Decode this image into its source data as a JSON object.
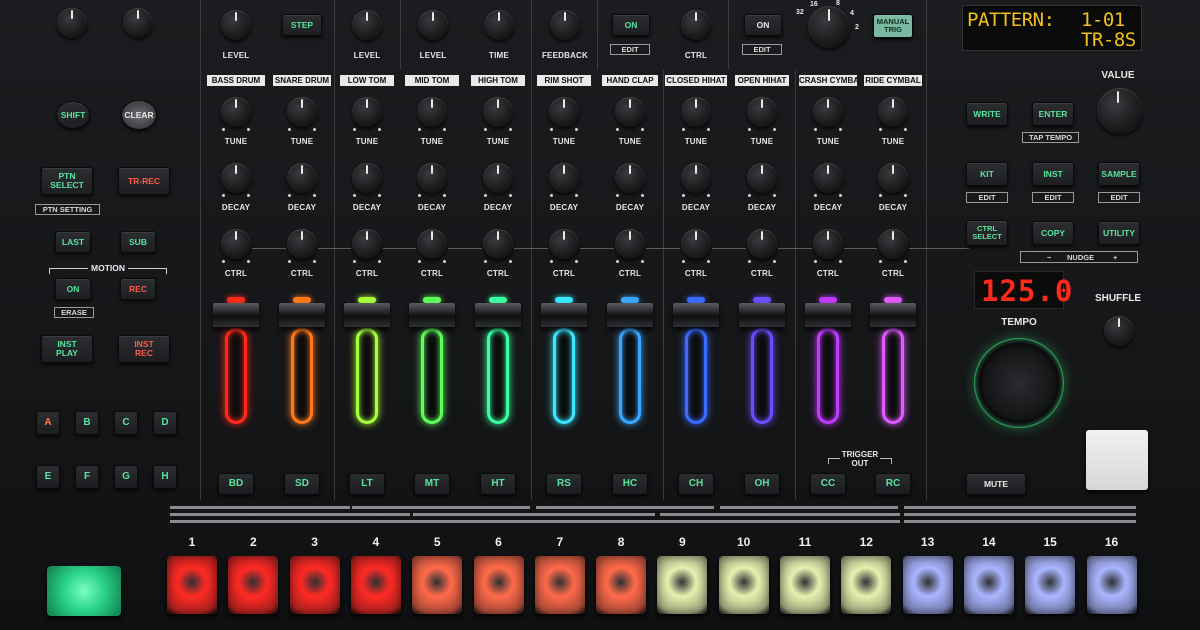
{
  "top": {
    "knob_labels": [
      "LEVEL",
      "LEVEL",
      "LEVEL",
      "TIME",
      "FEEDBACK",
      "CTRL"
    ],
    "step_label": "STEP",
    "on_label": "ON",
    "edit_label": "EDIT",
    "ctrl_label": "CTRL",
    "manual_trig": [
      "MANUAL",
      "TRIG"
    ],
    "step_values": [
      "32",
      "16",
      "8",
      "4",
      "2"
    ]
  },
  "display": {
    "line1_left": "PATTERN:",
    "line1_right": "1-01",
    "line2_right": "TR-8S"
  },
  "instruments": [
    {
      "header": "BASS DRUM",
      "button": "BD",
      "color": "#ff2a1a"
    },
    {
      "header": "SNARE DRUM",
      "button": "SD",
      "color": "#ff7a1a"
    },
    {
      "header": "LOW TOM",
      "button": "LT",
      "color": "#a8ff3a"
    },
    {
      "header": "MID TOM",
      "button": "MT",
      "color": "#5dff5a"
    },
    {
      "header": "HIGH TOM",
      "button": "HT",
      "color": "#3affa0"
    },
    {
      "header": "RIM SHOT",
      "button": "RS",
      "color": "#3ae6ff"
    },
    {
      "header": "HAND CLAP",
      "button": "HC",
      "color": "#3aa6ff"
    },
    {
      "header": "CLOSED HIHAT",
      "button": "CH",
      "color": "#3a6bff"
    },
    {
      "header": "OPEN HIHAT",
      "button": "OH",
      "color": "#6a4dff"
    },
    {
      "header": "CRASH CYMBAL",
      "button": "CC",
      "color": "#c23aff"
    },
    {
      "header": "RIDE CYMBAL",
      "button": "RC",
      "color": "#e05aff"
    }
  ],
  "knob_rows": [
    "TUNE",
    "DECAY",
    "CTRL"
  ],
  "left": {
    "shift": "SHIFT",
    "clear": "CLEAR",
    "ptn_select": [
      "PTN",
      "SELECT"
    ],
    "tr_rec": "TR-REC",
    "ptn_setting": "PTN SETTING",
    "last": "LAST",
    "sub": "SUB",
    "motion": "MOTION",
    "on": "ON",
    "rec": "REC",
    "erase": "ERASE",
    "inst_play": [
      "INST",
      "PLAY"
    ],
    "inst_rec": [
      "INST",
      "REC"
    ],
    "banks": [
      "A",
      "B",
      "C",
      "D",
      "E",
      "F",
      "G",
      "H"
    ]
  },
  "right": {
    "value": "VALUE",
    "write": "WRITE",
    "enter": "ENTER",
    "tap_tempo": "TAP TEMPO",
    "kit": "KIT",
    "inst": "INST",
    "sample": "SAMPLE",
    "edit": "EDIT",
    "ctrl_select": [
      "CTRL",
      "SELECT"
    ],
    "copy": "COPY",
    "utility": "UTILITY",
    "nudge": "NUDGE",
    "nudge_minus": "−",
    "nudge_plus": "+",
    "tempo_display": "125.0",
    "tempo": "TEMPO",
    "shuffle": "SHUFFLE",
    "mute": "MUTE"
  },
  "trigger_out": [
    "TRIGGER",
    "OUT"
  ],
  "steps": [
    {
      "num": "1",
      "color": "#ff2a24"
    },
    {
      "num": "2",
      "color": "#ff2a24"
    },
    {
      "num": "3",
      "color": "#ff2a24"
    },
    {
      "num": "4",
      "color": "#ff2a24"
    },
    {
      "num": "5",
      "color": "#ff6a4a"
    },
    {
      "num": "6",
      "color": "#ff6a4a"
    },
    {
      "num": "7",
      "color": "#ff6a4a"
    },
    {
      "num": "8",
      "color": "#ff6a4a"
    },
    {
      "num": "9",
      "color": "#e8f0b0"
    },
    {
      "num": "10",
      "color": "#e8f0b0"
    },
    {
      "num": "11",
      "color": "#e8f0b0"
    },
    {
      "num": "12",
      "color": "#e8f0b0"
    },
    {
      "num": "13",
      "color": "#aab6ff"
    },
    {
      "num": "14",
      "color": "#aab6ff"
    },
    {
      "num": "15",
      "color": "#aab6ff"
    },
    {
      "num": "16",
      "color": "#aab6ff"
    }
  ],
  "colors": {
    "green_text": "#59e39e",
    "red_text": "#ff5a4a",
    "tempo_led": "#ff2a1a",
    "lcd_text": "#f0c020",
    "ring": "#3aff8a"
  }
}
